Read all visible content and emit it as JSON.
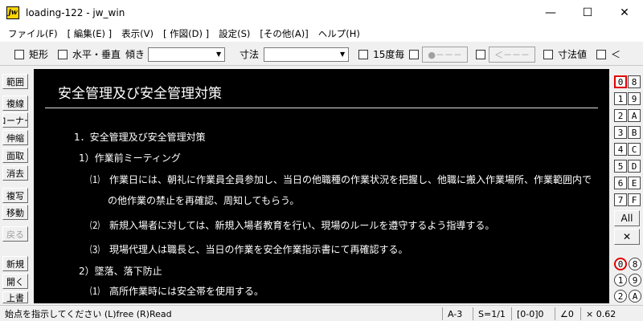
{
  "window": {
    "app_icon_text": "jw",
    "title": "loading-122 - jw_win",
    "minimize": "—",
    "maximize": "☐",
    "close": "✕"
  },
  "menu": [
    "ファイル(F)",
    "[ 編集(E) ]",
    "表示(V)",
    "[ 作図(D) ]",
    "設定(S)",
    "[その他(A)]",
    "ヘルプ(H)"
  ],
  "toolbar": {
    "rect": "矩形",
    "horiz_vert": "水平・垂直",
    "tilt": "傾き",
    "tilt_value": "",
    "dimension": "寸法",
    "dimension_value": "",
    "every15": "15度毎",
    "dot_btn": "●－－－",
    "arrow_btn": "＜－－－",
    "dim_value": "寸法値",
    "lt": "＜"
  },
  "left_tools": [
    "範囲",
    "複線",
    "コーナー",
    "伸縮",
    "面取",
    "消去",
    "複写",
    "移動",
    "戻る",
    "新規",
    "開く",
    "上書"
  ],
  "document": {
    "title": "安全管理及び安全管理対策",
    "lines": [
      "1．安全管理及び安全管理対策",
      "1）作業前ミーティング",
      "⑴　作業日には、朝礼に作業員全員参加し、当日の他職種の作業状況を把握し、他職に搬入作業場所、作業範囲内で",
      "の他作業の禁止を再確認、周知してもらう。",
      "⑵　新規入場者に対しては、新規入場者教育を行い、現場のルールを遵守するよう指導する。",
      "⑶　現場代理人は職長と、当日の作業を安全作業指示書にて再確認する。",
      "2）墜落、落下防止",
      "⑴　高所作業時には安全帯を使用する。"
    ]
  },
  "layers": {
    "left": [
      "0",
      "1",
      "2",
      "3",
      "4",
      "5",
      "6",
      "7"
    ],
    "right": [
      "8",
      "9",
      "A",
      "B",
      "C",
      "D",
      "E",
      "F"
    ],
    "all": "All",
    "cross": "✕",
    "groups_left": [
      "0",
      "1",
      "2"
    ],
    "groups_right": [
      "8",
      "9",
      "A"
    ]
  },
  "status": {
    "message": "始点を指示してください (L)free (R)Read",
    "paper": "A-3",
    "scale": "S=1/1",
    "layer": "[0-0]0",
    "angle": "∠0",
    "factor": "× 0.62"
  }
}
